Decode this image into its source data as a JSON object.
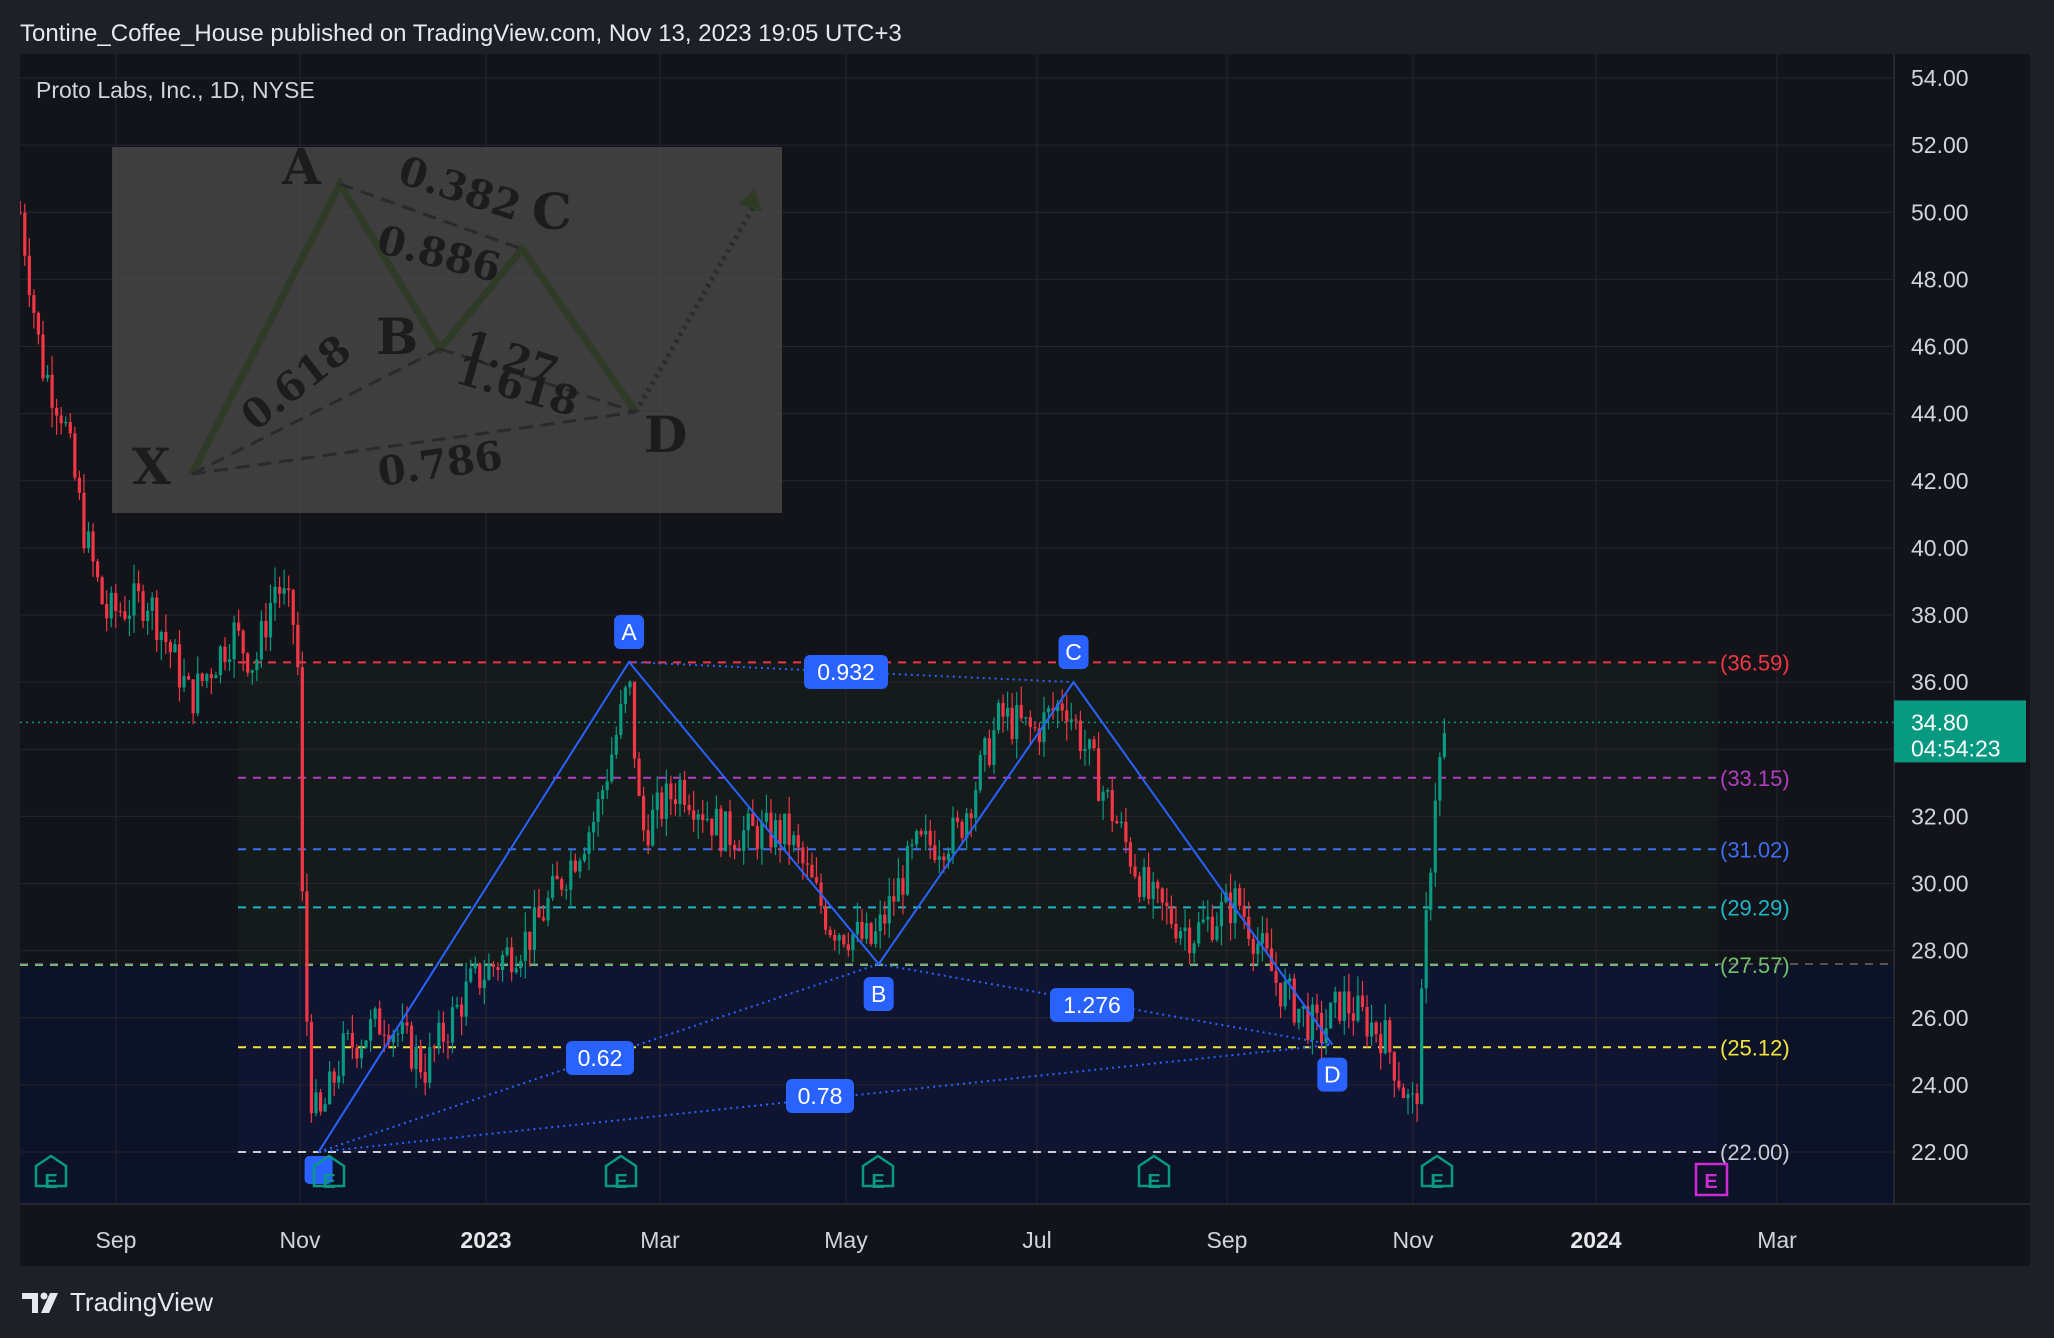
{
  "header": {
    "text": "Tontine_Coffee_House published on TradingView.com, Nov 13, 2023 19:05 UTC+3"
  },
  "symbol": {
    "label": "Proto Labs, Inc., 1D, NYSE"
  },
  "footer": {
    "brand": "TradingView",
    "logo_icon": "tradingview-logo-icon"
  },
  "price_axis": {
    "labels": [
      "54.00",
      "52.00",
      "50.00",
      "48.00",
      "46.00",
      "44.00",
      "42.00",
      "40.00",
      "38.00",
      "36.00",
      "32.00",
      "30.00",
      "28.00",
      "26.00",
      "24.00",
      "22.00"
    ],
    "current_price": "34.80",
    "countdown": "04:54:23",
    "current_color": "#089981"
  },
  "time_axis": {
    "labels": [
      "Sep",
      "Nov",
      "2023",
      "Mar",
      "May",
      "Jul",
      "Sep",
      "Nov",
      "2024",
      "Mar"
    ],
    "bold": [
      "2023",
      "2024"
    ]
  },
  "levels": [
    {
      "label": "(36.59)",
      "price": 36.59,
      "color": "#f23645"
    },
    {
      "label": "(33.15)",
      "price": 33.15,
      "color": "#b03fc1"
    },
    {
      "label": "(31.02)",
      "price": 31.02,
      "color": "#3d6ef0"
    },
    {
      "label": "(29.29)",
      "price": 29.29,
      "color": "#22b5c7"
    },
    {
      "label": "(27.57)",
      "price": 27.57,
      "color": "#6fc36a"
    },
    {
      "label": "(25.12)",
      "price": 25.12,
      "color": "#f2e43a"
    },
    {
      "label": "(22.00)",
      "price": 22.0,
      "color": "#c9ccd4"
    }
  ],
  "pattern": {
    "points": [
      "A",
      "B",
      "C",
      "D"
    ],
    "ratios": [
      "0.932",
      "0.62",
      "1.276",
      "0.78"
    ],
    "color": "#2962ff"
  },
  "inset_image": {
    "letters": [
      "A",
      "B",
      "C",
      "D",
      "X"
    ],
    "ratios": [
      "0.382",
      "0.886",
      "1.27",
      "0.618",
      "1.618",
      "0.786"
    ]
  },
  "earnings_marker": "E",
  "chart_data": {
    "type": "candlestick",
    "ylim": [
      20.2,
      55.0
    ],
    "series": [
      {
        "name": "",
        "anchors": [
          [
            "2022-08-01",
            50.0
          ],
          [
            "2022-08-08",
            45.5
          ],
          [
            "2022-08-15",
            44.0
          ],
          [
            "2022-08-22",
            40.5
          ],
          [
            "2022-08-29",
            38.0
          ],
          [
            "2022-09-12",
            38.5
          ],
          [
            "2022-09-26",
            35.5
          ],
          [
            "2022-10-10",
            37.5
          ],
          [
            "2022-10-17",
            36.5
          ],
          [
            "2022-10-24",
            39.0
          ],
          [
            "2022-10-31",
            37.5
          ],
          [
            "2022-11-01",
            31.0
          ],
          [
            "2022-11-04",
            24.0
          ],
          [
            "2022-11-07",
            22.8
          ],
          [
            "2022-11-15",
            25.0
          ],
          [
            "2022-11-29",
            26.0
          ],
          [
            "2022-12-12",
            24.5
          ],
          [
            "2022-12-27",
            27.0
          ],
          [
            "2023-01-16",
            28.5
          ],
          [
            "2023-02-06",
            32.0
          ],
          [
            "2023-02-13",
            34.5
          ],
          [
            "2023-02-17",
            36.0
          ],
          [
            "2023-02-21",
            31.5
          ],
          [
            "2023-03-06",
            33.0
          ],
          [
            "2023-03-20",
            31.5
          ],
          [
            "2023-04-10",
            31.5
          ],
          [
            "2023-04-24",
            28.8
          ],
          [
            "2023-05-08",
            28.2
          ],
          [
            "2023-05-22",
            31.0
          ],
          [
            "2023-06-05",
            31.5
          ],
          [
            "2023-06-19",
            35.0
          ],
          [
            "2023-06-30",
            34.5
          ],
          [
            "2023-07-10",
            35.5
          ],
          [
            "2023-07-17",
            34.0
          ],
          [
            "2023-07-31",
            31.0
          ],
          [
            "2023-08-07",
            29.5
          ],
          [
            "2023-08-21",
            28.5
          ],
          [
            "2023-09-05",
            29.5
          ],
          [
            "2023-09-18",
            27.0
          ],
          [
            "2023-10-02",
            25.5
          ],
          [
            "2023-10-09",
            26.5
          ],
          [
            "2023-10-23",
            25.5
          ],
          [
            "2023-11-01",
            23.2
          ],
          [
            "2023-11-03",
            24.0
          ],
          [
            "2023-11-06",
            29.0
          ],
          [
            "2023-11-09",
            33.0
          ],
          [
            "2023-11-13",
            34.8
          ]
        ]
      }
    ],
    "pattern": {
      "X": [
        "2022-11-07",
        22.0
      ],
      "A": [
        "2023-02-17",
        36.6
      ],
      "B": [
        "2023-05-10",
        27.6
      ],
      "C": [
        "2023-07-13",
        36.0
      ],
      "D": [
        "2023-10-06",
        25.2
      ]
    },
    "earnings_dates": [
      "2022-08-04",
      "2022-11-03",
      "2023-02-15",
      "2023-05-04",
      "2023-08-03",
      "2023-11-02",
      "2024-02-08"
    ]
  }
}
